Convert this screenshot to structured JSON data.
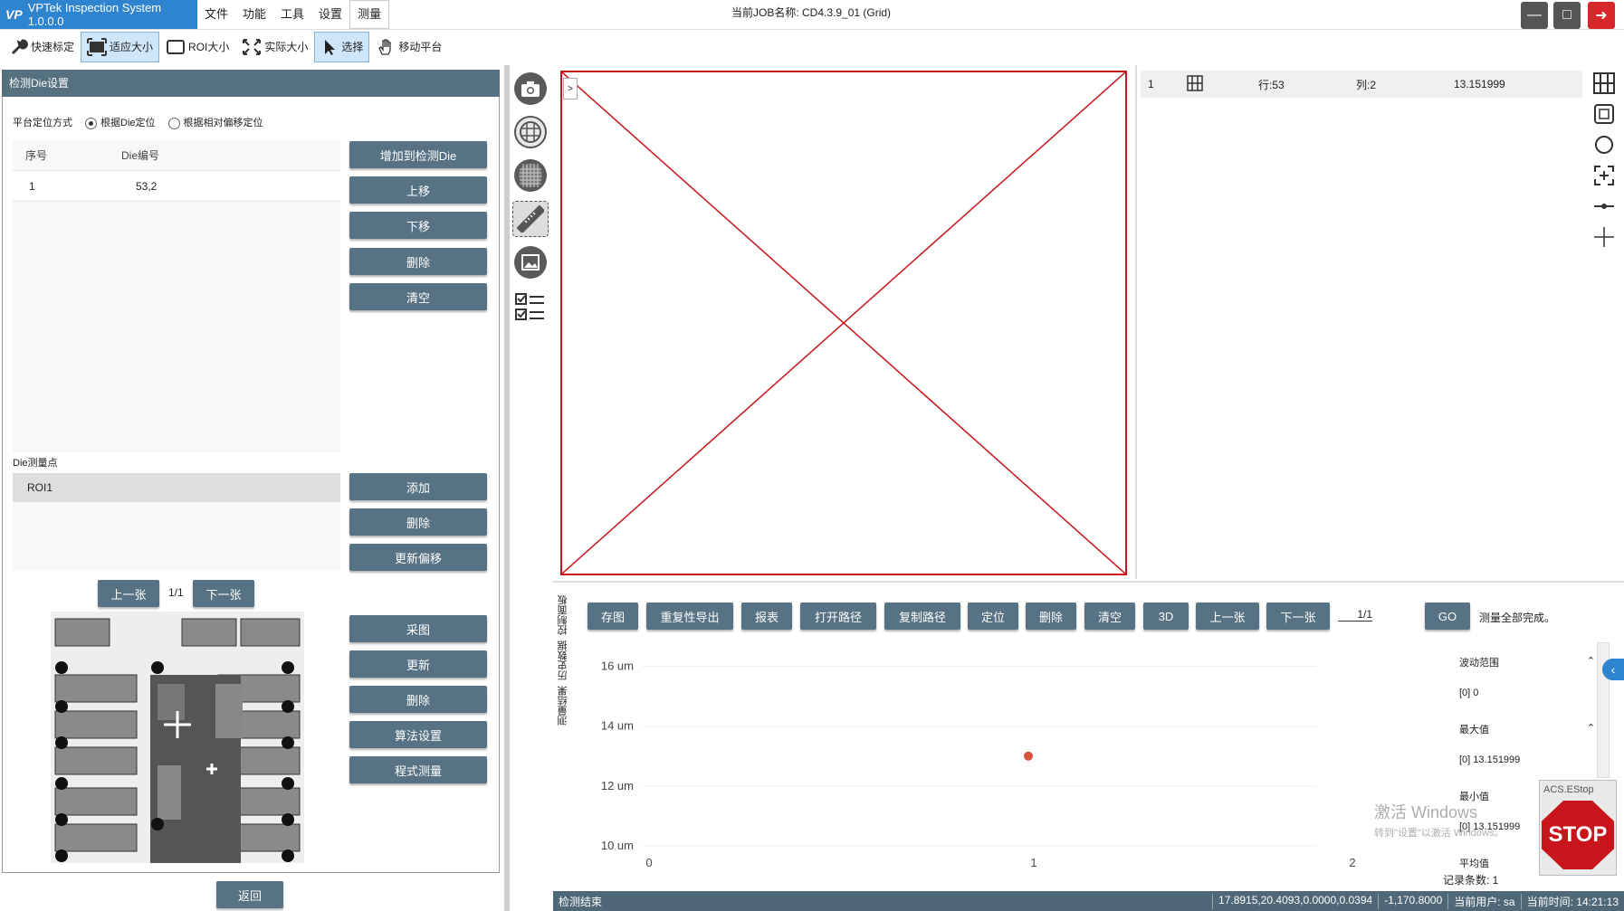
{
  "app": {
    "title": "VPTek Inspection System 1.0.0.0",
    "logo_mark": "VP",
    "menu": [
      "文件",
      "功能",
      "工具",
      "设置",
      "测量"
    ],
    "job_label": "当前JOB名称:  CD4.3.9_01 (Grid)"
  },
  "toolbar": {
    "items": [
      "快速标定",
      "适应大小",
      "ROI大小",
      "实际大小",
      "选择",
      "移动平台"
    ]
  },
  "left_panel": {
    "title": "检测Die设置",
    "positioning_label": "平台定位方式",
    "radio_die": "根据Die定位",
    "radio_offset": "根据相对偏移定位",
    "table_headers": [
      "序号",
      "Die编号"
    ],
    "table_rows": [
      [
        "1",
        "53,2"
      ]
    ],
    "die_buttons": [
      "增加到检测Die",
      "上移",
      "下移",
      "删除",
      "清空"
    ],
    "points_label": "Die测量点",
    "points": [
      "ROI1"
    ],
    "point_buttons": [
      "添加",
      "删除",
      "更新偏移"
    ],
    "prev": "上一张",
    "page": "1/1",
    "next": "下一张",
    "image_buttons": [
      "采图",
      "更新",
      "删除",
      "算法设置",
      "程式测量"
    ],
    "back": "返回"
  },
  "result": {
    "index": "1",
    "row": "行:53",
    "col": "列:2",
    "value": "13.151999"
  },
  "bottom": {
    "side_tabs": [
      "测量结果",
      "历史数据",
      "控制面板"
    ],
    "buttons": [
      "存图",
      "重复性导出",
      "报表",
      "打开路径",
      "复制路径",
      "定位",
      "删除",
      "清空",
      "3D",
      "上一张",
      "下一张"
    ],
    "page": "1/1",
    "go": "GO",
    "status_msg": "测量全部完成。"
  },
  "chart_data": {
    "type": "scatter",
    "x": [
      1
    ],
    "y": [
      13.0
    ],
    "xticks": [
      "0",
      "1",
      "2"
    ],
    "yticks": [
      "16 um",
      "14 um",
      "12 um",
      "10 um"
    ],
    "xlim": [
      0,
      2
    ],
    "ylim": [
      10,
      16.5
    ],
    "point_color": "#d9533f"
  },
  "stats": {
    "range_label": "波动范围",
    "range_value": "[0]   0",
    "max_label": "最大值",
    "max_value": "[0]   13.151999",
    "min_label": "最小值",
    "min_value": "[0]   13.151999",
    "avg_label": "平均值",
    "count": "记录条数: 1"
  },
  "estop": {
    "title": "ACS.EStop",
    "label": "STOP"
  },
  "watermark": {
    "line1": "激活 Windows",
    "line2": "转到\"设置\"以激活 Windows。"
  },
  "statusbar": {
    "left": "检测结束",
    "coords": "17.8915,20.4093,0.0000,0.0394",
    "z": "-1,170.8000",
    "user": "当前用户:  sa",
    "time": "当前时间:  14:21:13"
  },
  "colors": {
    "accent": "#2f84d0",
    "button": "#567284",
    "frame": "#c8141b",
    "estop": "#c8141b"
  }
}
